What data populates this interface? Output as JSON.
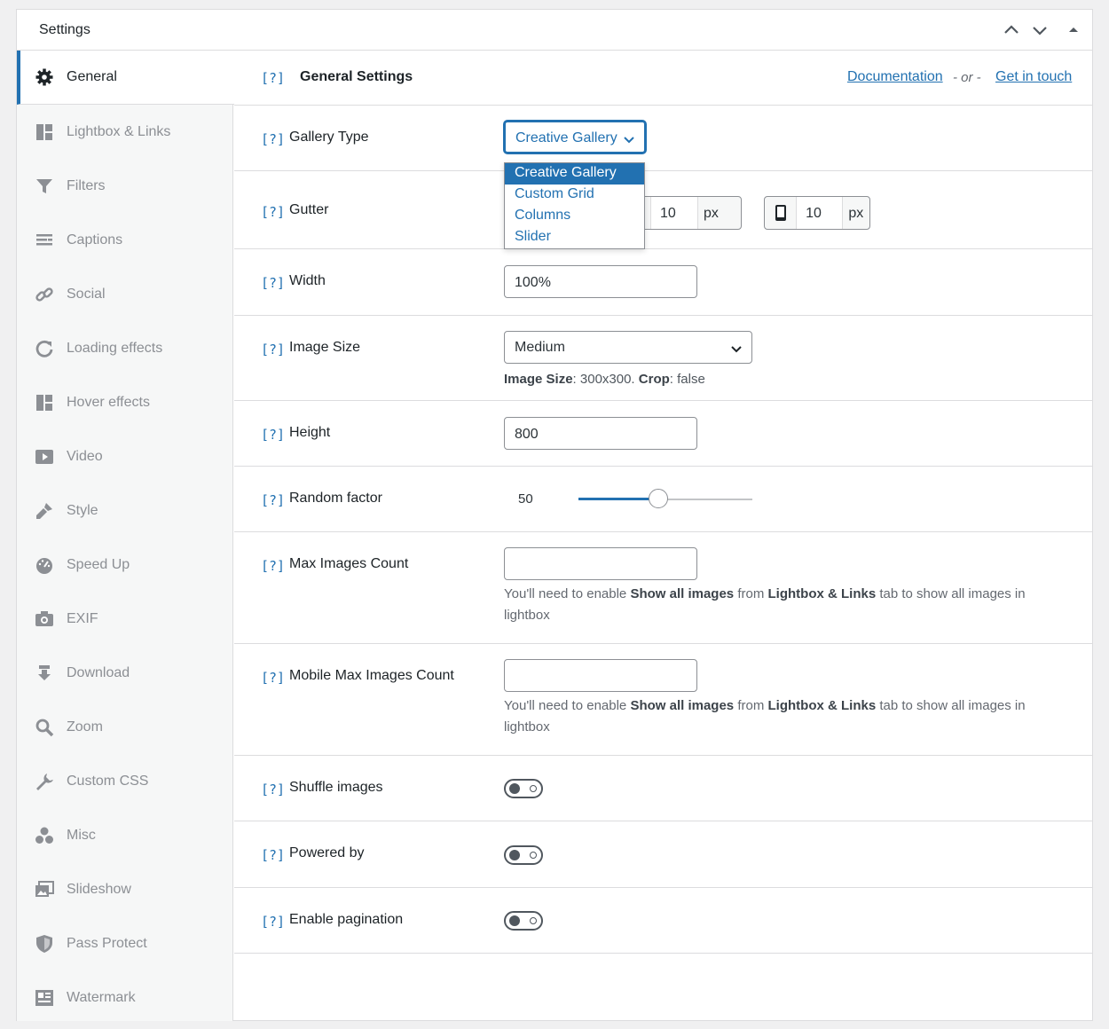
{
  "panel": {
    "title": "Settings"
  },
  "sidebar": {
    "items": [
      {
        "label": "General"
      },
      {
        "label": "Lightbox & Links"
      },
      {
        "label": "Filters"
      },
      {
        "label": "Captions"
      },
      {
        "label": "Social"
      },
      {
        "label": "Loading effects"
      },
      {
        "label": "Hover effects"
      },
      {
        "label": "Video"
      },
      {
        "label": "Style"
      },
      {
        "label": "Speed Up"
      },
      {
        "label": "EXIF"
      },
      {
        "label": "Download"
      },
      {
        "label": "Zoom"
      },
      {
        "label": "Custom CSS"
      },
      {
        "label": "Misc"
      },
      {
        "label": "Slideshow"
      },
      {
        "label": "Pass Protect"
      },
      {
        "label": "Watermark"
      }
    ],
    "active_index": 0
  },
  "main": {
    "help_text": "[?]",
    "title": "General Settings",
    "documentation_link": "Documentation",
    "or_text": "- or -",
    "contact_link": "Get in touch"
  },
  "fields": {
    "gallery_type": {
      "label": "Gallery Type",
      "value": "Creative Gallery",
      "options": [
        "Creative Gallery",
        "Custom Grid",
        "Columns",
        "Slider"
      ]
    },
    "gutter": {
      "label": "Gutter",
      "tablet_value": "10",
      "mobile_value": "10",
      "unit": "px"
    },
    "width": {
      "label": "Width",
      "value": "100%"
    },
    "image_size": {
      "label": "Image Size",
      "value": "Medium",
      "info_label": "Image Size",
      "info_size": ": 300x300. ",
      "info_crop_label": "Crop",
      "info_crop": ": false"
    },
    "height": {
      "label": "Height",
      "value": "800"
    },
    "random_factor": {
      "label": "Random factor",
      "value": 50,
      "min": 0,
      "max": 100,
      "display": "50"
    },
    "max_images": {
      "label": "Max Images Count",
      "value": "",
      "desc_1": "You'll need to enable ",
      "desc_b1": "Show all images",
      "desc_2": " from ",
      "desc_b2": "Lightbox & Links",
      "desc_3": " tab to show all images in lightbox"
    },
    "mobile_max_images": {
      "label": "Mobile Max Images Count",
      "value": "",
      "desc_1": "You'll need to enable ",
      "desc_b1": "Show all images",
      "desc_2": " from ",
      "desc_b2": "Lightbox & Links",
      "desc_3": " tab to show all images in lightbox"
    },
    "shuffle": {
      "label": "Shuffle images",
      "enabled": false
    },
    "powered_by": {
      "label": "Powered by",
      "enabled": false
    },
    "pagination": {
      "label": "Enable pagination",
      "enabled": false
    }
  },
  "colors": {
    "accent": "#2271b1",
    "muted": "#8c8f94",
    "border": "#dcdcde"
  }
}
